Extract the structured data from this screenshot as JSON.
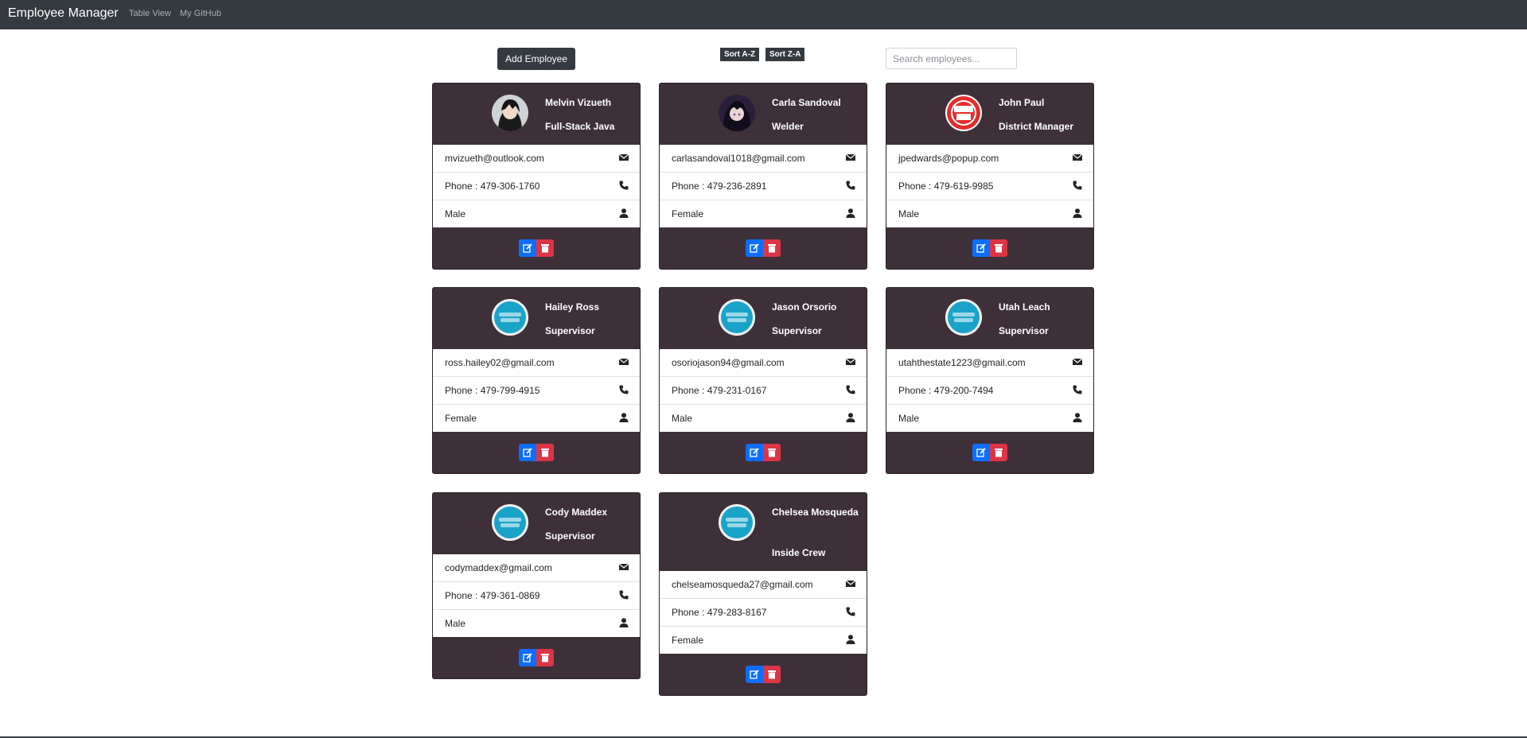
{
  "app": {
    "brand": "Employee Manager"
  },
  "nav": {
    "links": [
      "Table View",
      "My GitHub"
    ]
  },
  "toolbar": {
    "add_label": "Add Employee",
    "sort_az": "Sort A-Z",
    "sort_za": "Sort Z-A",
    "search_placeholder": "Search employees..."
  },
  "icons": {
    "email": "envelope-icon",
    "phone": "phone-icon",
    "gender": "person-icon",
    "edit": "edit-icon",
    "delete": "trash-icon"
  },
  "colors": {
    "card_bg": "#3e3039",
    "edit": "#0d6efd",
    "delete": "#dc3545",
    "navbar": "#343a40"
  },
  "employees": [
    {
      "name": "Melvin Vizueth",
      "title": "Full-Stack Java",
      "email": "mvizueth@outlook.com",
      "phone": "Phone : 479-306-1760",
      "gender": "Male",
      "avatar": "anime-dark-avatar"
    },
    {
      "name": "Carla Sandoval",
      "title": "Welder",
      "email": "carlasandoval1018@gmail.com",
      "phone": "Phone : 479-236-2891",
      "gender": "Female",
      "avatar": "anime-purple-avatar"
    },
    {
      "name": "John Paul",
      "title": "District Manager",
      "email": "jpedwards@popup.com",
      "phone": "Phone : 479-619-9985",
      "gender": "Male",
      "avatar": "popup-logo-avatar"
    },
    {
      "name": "Hailey Ross",
      "title": "Supervisor",
      "email": "ross.hailey02@gmail.com",
      "phone": "Phone : 479-799-4915",
      "gender": "Female",
      "avatar": "blue-logo-avatar"
    },
    {
      "name": "Jason Orsorio",
      "title": "Supervisor",
      "email": "osoriojason94@gmail.com",
      "phone": "Phone : 479-231-0167",
      "gender": "Male",
      "avatar": "blue-logo-avatar"
    },
    {
      "name": "Utah Leach",
      "title": "Supervisor",
      "email": "utahthestate1223@gmail.com",
      "phone": "Phone : 479-200-7494",
      "gender": "Male",
      "avatar": "blue-logo-avatar"
    },
    {
      "name": "Cody Maddex",
      "title": "Supervisor",
      "email": "codymaddex@gmail.com",
      "phone": "Phone : 479-361-0869",
      "gender": "Male",
      "avatar": "blue-logo-avatar"
    },
    {
      "name": "Chelsea Mosqueda",
      "title": "Inside Crew",
      "email": "chelseamosqueda27@gmail.com",
      "phone": "Phone : 479-283-8167",
      "gender": "Female",
      "avatar": "blue-logo-avatar"
    }
  ]
}
